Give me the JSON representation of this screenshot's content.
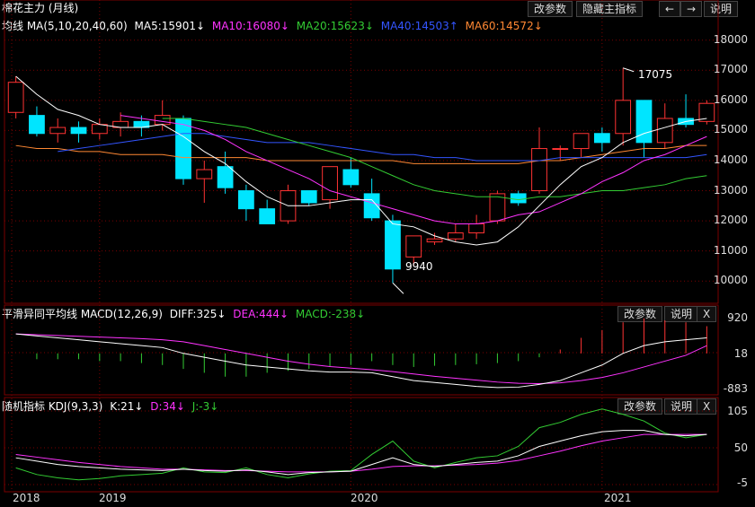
{
  "main": {
    "title": "棉花主力 (月线)",
    "ma_label": "均线 MA(5,10,20,40,60)",
    "ma5": "MA5:15901↓",
    "ma10": "MA10:16080↓",
    "ma20": "MA20:15623↓",
    "ma40": "MA40:14503↑",
    "ma60": "MA60:14572↓",
    "btn_params": "改参数",
    "btn_hide": "隐藏主指标",
    "btn_left": "←",
    "btn_right": "→",
    "btn_help": "说明",
    "high_label": "17075",
    "low_label": "9940"
  },
  "macd": {
    "title": "平滑异同平均线 MACD(12,26,9)",
    "diff": "DIFF:325↓",
    "dea": "DEA:444↓",
    "macd": "MACD:-238↓",
    "btn_params": "改参数",
    "btn_help": "说明",
    "btn_close": "X",
    "y_top": "920",
    "y_mid": "18",
    "y_bot": "-883"
  },
  "kdj": {
    "title": "随机指标 KDJ(9,3,3)",
    "k": "K:21↓",
    "d": "D:34↓",
    "j": "J:-3↓",
    "btn_params": "改参数",
    "btn_help": "说明",
    "btn_close": "X",
    "y_105": "105",
    "y_50": "50",
    "y_neg5": "-5"
  },
  "colors": {
    "up": "#ff3333",
    "down": "#00e5ff",
    "ma5": "#ffffff",
    "ma10": "#ff33ff",
    "ma20": "#33cc33",
    "ma40": "#3355ff",
    "ma60": "#ff8833",
    "grid": "#7a0000"
  },
  "chart_data": [
    {
      "type": "candlestick",
      "ylim": [
        9500,
        18200
      ],
      "y_ticks": [
        "18000",
        "17000",
        "16000",
        "15000",
        "14000",
        "13000",
        "12000",
        "11000",
        "10000"
      ],
      "x_ticks": [
        "2018",
        "2019",
        "2020",
        "2021"
      ],
      "candles": [
        {
          "o": 15600,
          "h": 16800,
          "l": 15400,
          "c": 16600
        },
        {
          "o": 15500,
          "h": 15800,
          "l": 14800,
          "c": 14900
        },
        {
          "o": 14900,
          "h": 15400,
          "l": 14600,
          "c": 15100
        },
        {
          "o": 15100,
          "h": 15300,
          "l": 14600,
          "c": 14900
        },
        {
          "o": 14900,
          "h": 15400,
          "l": 14700,
          "c": 15200
        },
        {
          "o": 15100,
          "h": 15600,
          "l": 14800,
          "c": 15300
        },
        {
          "o": 15300,
          "h": 15500,
          "l": 14800,
          "c": 15100
        },
        {
          "o": 15200,
          "h": 16000,
          "l": 15000,
          "c": 15500
        },
        {
          "o": 15400,
          "h": 15500,
          "l": 13200,
          "c": 13400
        },
        {
          "o": 13400,
          "h": 14000,
          "l": 12600,
          "c": 13700
        },
        {
          "o": 13800,
          "h": 14300,
          "l": 12900,
          "c": 13100
        },
        {
          "o": 13000,
          "h": 13200,
          "l": 12000,
          "c": 12400
        },
        {
          "o": 12400,
          "h": 12700,
          "l": 11900,
          "c": 11900
        },
        {
          "o": 12000,
          "h": 13200,
          "l": 11900,
          "c": 13000
        },
        {
          "o": 13000,
          "h": 13000,
          "l": 12500,
          "c": 12600
        },
        {
          "o": 12700,
          "h": 13800,
          "l": 12400,
          "c": 13800
        },
        {
          "o": 13700,
          "h": 14100,
          "l": 13100,
          "c": 13200
        },
        {
          "o": 12900,
          "h": 13400,
          "l": 12000,
          "c": 12100
        },
        {
          "o": 12000,
          "h": 12200,
          "l": 9940,
          "c": 10400
        },
        {
          "o": 10800,
          "h": 11500,
          "l": 10500,
          "c": 11500
        },
        {
          "o": 11300,
          "h": 11600,
          "l": 11200,
          "c": 11400
        },
        {
          "o": 11400,
          "h": 11900,
          "l": 11300,
          "c": 11600
        },
        {
          "o": 11600,
          "h": 12200,
          "l": 11400,
          "c": 11900
        },
        {
          "o": 12000,
          "h": 13000,
          "l": 11900,
          "c": 12900
        },
        {
          "o": 12900,
          "h": 13000,
          "l": 12500,
          "c": 12600
        },
        {
          "o": 13000,
          "h": 15100,
          "l": 12900,
          "c": 14400
        },
        {
          "o": 14400,
          "h": 14500,
          "l": 14000,
          "c": 14400
        },
        {
          "o": 14400,
          "h": 14900,
          "l": 14100,
          "c": 14900
        },
        {
          "o": 14900,
          "h": 15100,
          "l": 14300,
          "c": 14600
        },
        {
          "o": 14900,
          "h": 17075,
          "l": 14500,
          "c": 16000
        },
        {
          "o": 16000,
          "h": 16000,
          "l": 14100,
          "c": 14600
        },
        {
          "o": 14600,
          "h": 15900,
          "l": 14400,
          "c": 15400
        },
        {
          "o": 15400,
          "h": 16200,
          "l": 15100,
          "c": 15200
        },
        {
          "o": 15300,
          "h": 16000,
          "l": 15200,
          "c": 15900
        }
      ],
      "ma5": [
        16800,
        16200,
        15700,
        15500,
        15200,
        15100,
        15100,
        15200,
        14800,
        14300,
        13900,
        13300,
        12800,
        12500,
        12500,
        12600,
        12700,
        12700,
        11900,
        11800,
        11500,
        11300,
        11200,
        11300,
        11800,
        12500,
        13200,
        13800,
        14100,
        14600,
        14900,
        15100,
        15300,
        15400
      ],
      "ma10": [
        null,
        null,
        null,
        null,
        null,
        15500,
        15400,
        15300,
        15200,
        15000,
        14700,
        14300,
        14000,
        13700,
        13400,
        13000,
        12800,
        12600,
        12400,
        12200,
        12000,
        11900,
        11900,
        12000,
        12200,
        12300,
        12600,
        12900,
        13300,
        13600,
        14000,
        14200,
        14500,
        14800
      ],
      "ma20": [
        null,
        null,
        null,
        null,
        null,
        null,
        null,
        15400,
        15400,
        15300,
        15200,
        15100,
        14900,
        14700,
        14500,
        14300,
        14100,
        13800,
        13500,
        13200,
        13000,
        12900,
        12800,
        12800,
        12700,
        12800,
        12800,
        12900,
        13000,
        13000,
        13100,
        13200,
        13400,
        13500
      ],
      "ma40": [
        null,
        null,
        14300,
        14400,
        14500,
        14600,
        14700,
        14800,
        14900,
        14900,
        14800,
        14700,
        14600,
        14600,
        14600,
        14500,
        14400,
        14300,
        14200,
        14200,
        14100,
        14100,
        14000,
        14000,
        14000,
        14000,
        14100,
        14100,
        14100,
        14100,
        14100,
        14100,
        14100,
        14200
      ],
      "ma60": [
        14500,
        14400,
        14400,
        14300,
        14300,
        14200,
        14200,
        14200,
        14100,
        14100,
        14100,
        14100,
        14000,
        14000,
        14000,
        14000,
        14000,
        14000,
        14000,
        13900,
        13900,
        13900,
        13900,
        13900,
        13900,
        14000,
        14000,
        14100,
        14200,
        14300,
        14400,
        14400,
        14500,
        14500
      ]
    },
    {
      "type": "bar",
      "name": "MACD",
      "ylim": [
        -883,
        920
      ],
      "diff": [
        500,
        450,
        400,
        350,
        300,
        250,
        200,
        150,
        0,
        -100,
        -200,
        -300,
        -350,
        -400,
        -450,
        -480,
        -480,
        -500,
        -600,
        -700,
        -750,
        -800,
        -850,
        -880,
        -870,
        -800,
        -700,
        -500,
        -300,
        0,
        200,
        300,
        350,
        400
      ],
      "dea": [
        500,
        480,
        460,
        440,
        420,
        400,
        380,
        350,
        300,
        200,
        100,
        0,
        -100,
        -200,
        -280,
        -340,
        -380,
        -420,
        -470,
        -530,
        -590,
        -640,
        -690,
        -740,
        -770,
        -780,
        -760,
        -700,
        -620,
        -500,
        -350,
        -200,
        -50,
        200
      ],
      "macd": [
        0,
        -150,
        -150,
        -150,
        -200,
        -200,
        -250,
        -300,
        -400,
        -500,
        -600,
        -600,
        -500,
        -450,
        -400,
        -350,
        -300,
        -200,
        -300,
        -350,
        -320,
        -300,
        -280,
        -250,
        -200,
        -100,
        100,
        400,
        600,
        800,
        900,
        850,
        800,
        700
      ]
    },
    {
      "type": "line",
      "name": "KDJ",
      "ylim": [
        -5,
        105
      ],
      "k": [
        35,
        30,
        25,
        22,
        20,
        18,
        17,
        16,
        18,
        16,
        15,
        17,
        14,
        10,
        13,
        14,
        15,
        25,
        35,
        25,
        22,
        25,
        28,
        30,
        38,
        52,
        60,
        68,
        74,
        76,
        76,
        70,
        68,
        70
      ],
      "d": [
        40,
        36,
        32,
        28,
        25,
        22,
        20,
        18,
        18,
        17,
        16,
        16,
        15,
        14,
        14,
        14,
        15,
        18,
        22,
        23,
        23,
        24,
        25,
        27,
        31,
        38,
        45,
        53,
        60,
        65,
        70,
        70,
        70,
        70
      ],
      "j": [
        20,
        10,
        5,
        2,
        4,
        8,
        10,
        12,
        20,
        14,
        13,
        20,
        10,
        5,
        11,
        15,
        16,
        40,
        60,
        30,
        20,
        28,
        35,
        38,
        52,
        80,
        88,
        100,
        108,
        100,
        90,
        72,
        65,
        70
      ]
    }
  ]
}
